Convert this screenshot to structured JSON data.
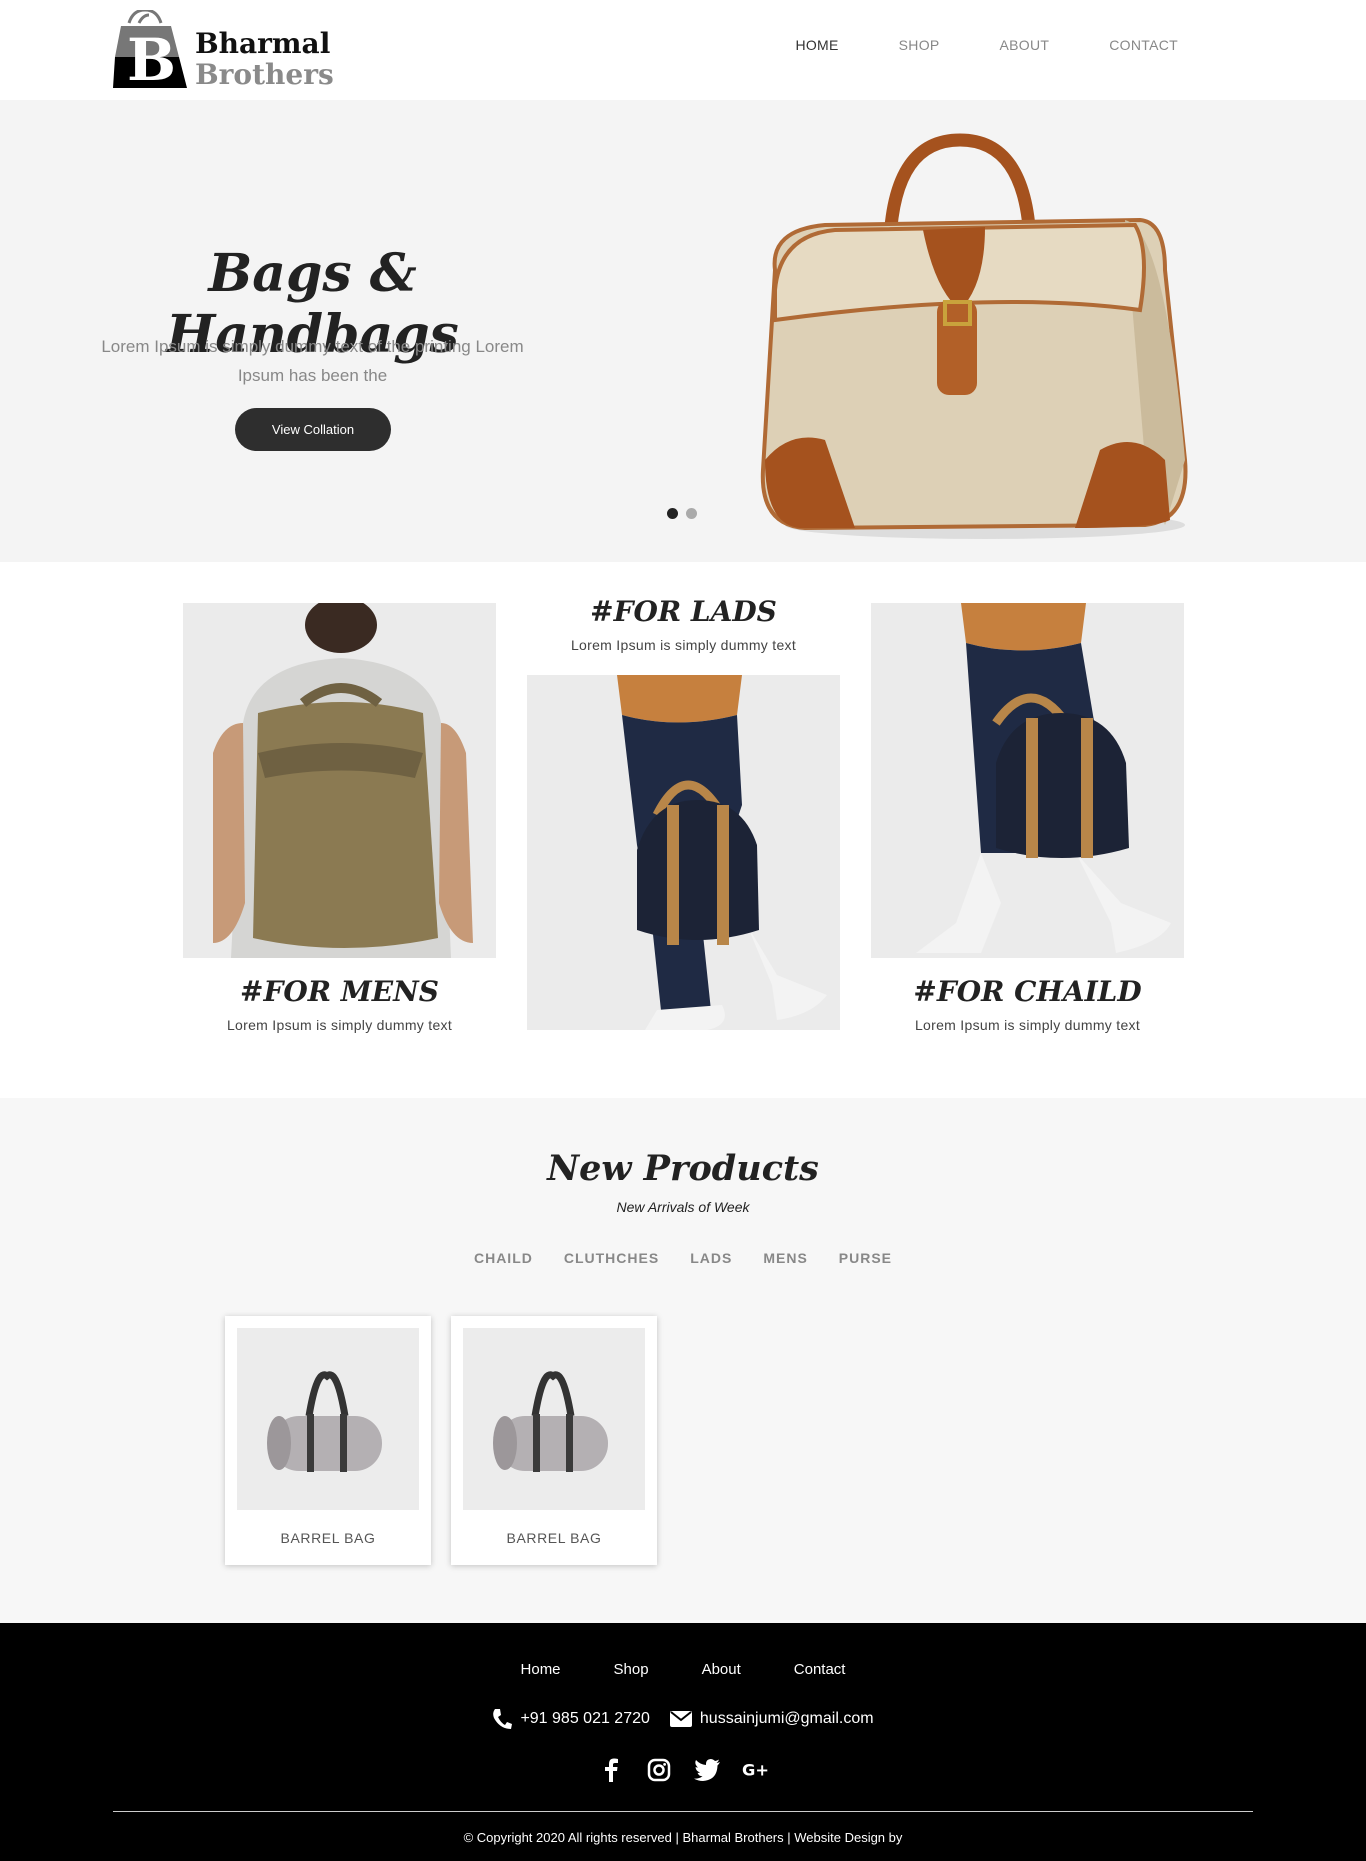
{
  "brand": {
    "line1": "Bharmal",
    "line2": "Brothers"
  },
  "nav": {
    "items": [
      {
        "label": "HOME",
        "active": true
      },
      {
        "label": "SHOP",
        "active": false
      },
      {
        "label": "ABOUT",
        "active": false
      },
      {
        "label": "CONTACT",
        "active": false
      }
    ]
  },
  "hero": {
    "title": "Bags & Handbags",
    "text": "Lorem Ipsum is simply dummy text of the printing Lorem Ipsum has been the",
    "button": "View Collation",
    "slides": 2,
    "active_slide": 1
  },
  "categories": [
    {
      "title": "#FOR MENS",
      "text": "Lorem Ipsum is simply dummy text"
    },
    {
      "title": "#FOR LADS",
      "text": "Lorem Ipsum is simply dummy text"
    },
    {
      "title": "#FOR CHAILD",
      "text": "Lorem Ipsum is simply dummy text"
    }
  ],
  "new_products": {
    "title": "New Products",
    "subtitle": "New Arrivals of Week",
    "filters": [
      "CHAILD",
      "CLUTHCHES",
      "LADS",
      "MENS",
      "PURSE"
    ],
    "items": [
      {
        "name": "BARREL BAG"
      },
      {
        "name": "BARREL BAG"
      }
    ]
  },
  "footer": {
    "nav": [
      "Home",
      "Shop",
      "About",
      "Contact"
    ],
    "phone": "+91 985 021 2720",
    "email": "hussainjumi@gmail.com",
    "social": [
      "facebook-icon",
      "instagram-icon",
      "twitter-icon",
      "google-plus-icon"
    ],
    "copyright": "© Copyright 2020 All rights reserved | Bharmal Brothers | Website Design by"
  }
}
